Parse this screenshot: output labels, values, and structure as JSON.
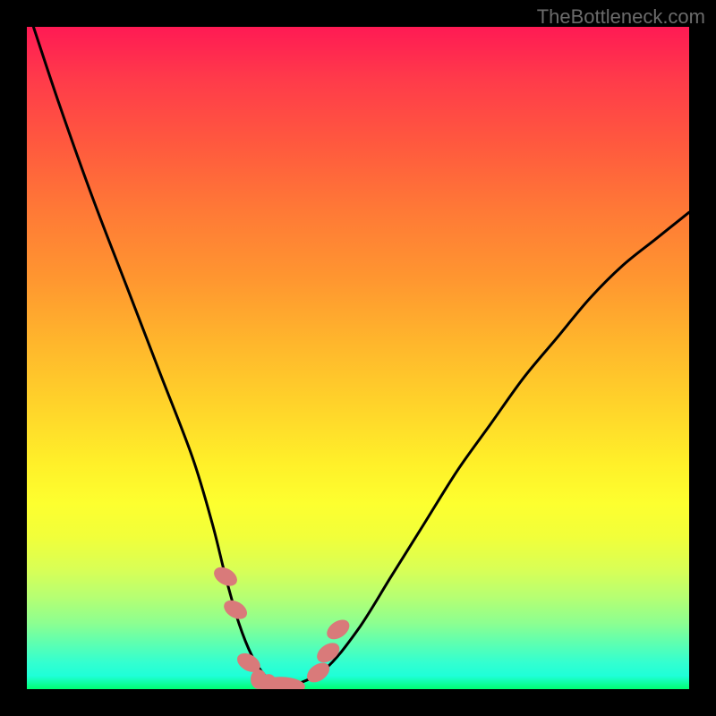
{
  "attribution": "TheBottleneck.com",
  "colors": {
    "curve_stroke": "#000000",
    "marker_fill": "#d97a7a",
    "marker_stroke": "#c96a6a"
  },
  "chart_data": {
    "type": "line",
    "title": "",
    "xlabel": "",
    "ylabel": "",
    "xlim": [
      0,
      100
    ],
    "ylim": [
      0,
      100
    ],
    "note": "V-shaped bottleneck curve over a traffic-light heatmap. Axis ticks/values are not rendered in the image; points below are estimated from pixel positions on a normalized 0–100 grid (y = 0 at bottom, 100 at top).",
    "series": [
      {
        "name": "bottleneck-curve",
        "x": [
          1,
          5,
          10,
          15,
          20,
          25,
          28,
          30,
          32,
          34,
          36,
          38,
          40,
          45,
          50,
          55,
          60,
          65,
          70,
          75,
          80,
          85,
          90,
          95,
          100
        ],
        "y": [
          100,
          88,
          74,
          61,
          48,
          35,
          25,
          17,
          10,
          5,
          2,
          0.5,
          0.5,
          3,
          9,
          17,
          25,
          33,
          40,
          47,
          53,
          59,
          64,
          68,
          72
        ]
      }
    ],
    "markers": [
      {
        "x": 30,
        "y": 17,
        "shape": "round"
      },
      {
        "x": 31.5,
        "y": 12,
        "shape": "round"
      },
      {
        "x": 33.5,
        "y": 4,
        "shape": "round"
      },
      {
        "x": 35,
        "y": 1.5,
        "shape": "short"
      },
      {
        "x": 36.5,
        "y": 0.8,
        "shape": "short"
      },
      {
        "x": 38.5,
        "y": 0.5,
        "shape": "pill"
      },
      {
        "x": 44,
        "y": 2.5,
        "shape": "round"
      },
      {
        "x": 45.5,
        "y": 5.5,
        "shape": "round"
      },
      {
        "x": 47,
        "y": 9,
        "shape": "round"
      }
    ]
  }
}
